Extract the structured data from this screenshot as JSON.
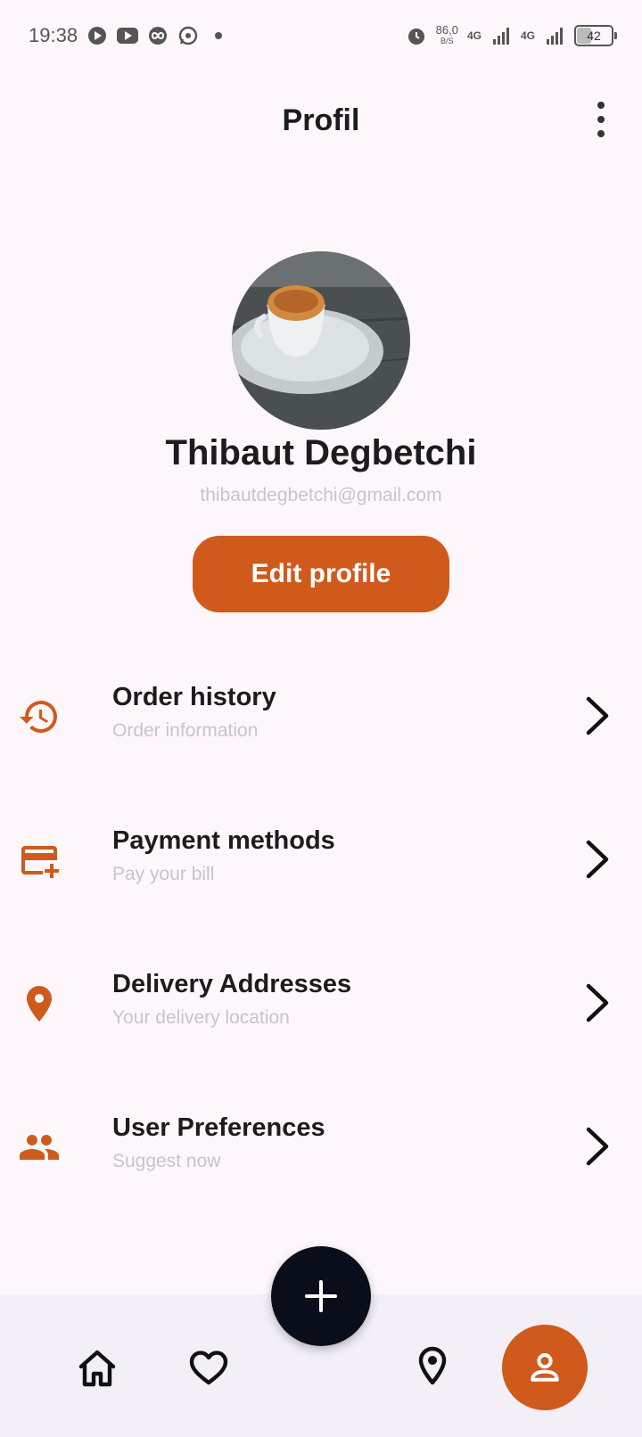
{
  "status_bar": {
    "time": "19:38",
    "speed_value": "86,0",
    "speed_unit": "B/S",
    "network_1": "4G",
    "network_2": "4G",
    "battery": "42"
  },
  "app_bar": {
    "title": "Profil",
    "more_icon": "more-vert-icon"
  },
  "profile": {
    "name": "Thibaut Degbetchi",
    "email": "thibautdegbetchi@gmail.com",
    "edit_label": "Edit profile"
  },
  "menu": {
    "items": [
      {
        "icon": "history-icon",
        "title": "Order history",
        "subtitle": "Order information"
      },
      {
        "icon": "add-card-icon",
        "title": "Payment methods",
        "subtitle": "Pay your bill"
      },
      {
        "icon": "location-pin-icon",
        "title": "Delivery Addresses",
        "subtitle": "Your delivery location"
      },
      {
        "icon": "people-icon",
        "title": "User Preferences",
        "subtitle": "Suggest now"
      }
    ]
  },
  "bottom_nav": {
    "items": [
      "home-icon",
      "heart-icon",
      "add-icon",
      "location-outline-icon",
      "person-icon"
    ],
    "active": "person-icon"
  },
  "colors": {
    "accent": "#d05a1c",
    "fab": "#0a0e1a",
    "background": "#fdf7fb",
    "nav_background": "#f3eff6"
  }
}
